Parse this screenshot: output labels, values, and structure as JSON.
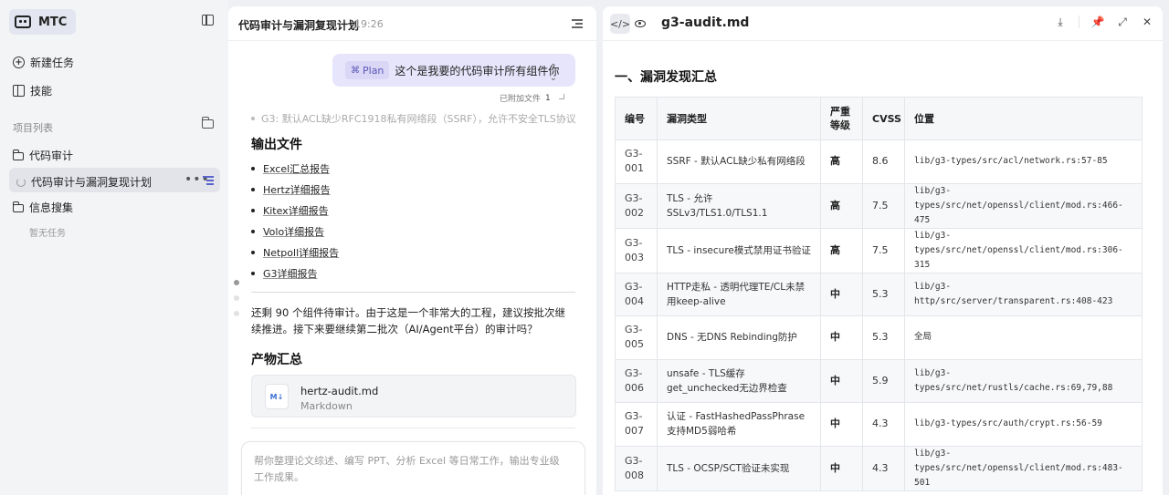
{
  "sidebar": {
    "brand": "MTC",
    "new_task": "新建任务",
    "skills": "技能",
    "section_label": "项目列表",
    "projects": [
      {
        "label": "代码审计"
      },
      {
        "label": "代码审计与漏洞复现计划"
      },
      {
        "label": "信息搜集"
      }
    ],
    "empty_text": "暂无任务",
    "more": "•••"
  },
  "chat": {
    "title": "代码审计与漏洞复现计划",
    "time": "19:26",
    "plan_tag": "Plan",
    "plan_text": "这个是我要的代码审计所有组件你",
    "attached_label": "已附加文件",
    "attached_count": "1",
    "faded_line": "G3: 默认ACL缺少RFC1918私有网络段（SSRF），允许不安全TLS协议",
    "output_heading": "输出文件",
    "output_files": [
      "Excel汇总报告",
      "Hertz详细报告",
      "Kitex详细报告",
      "Volo详细报告",
      "Netpoll详细报告",
      "G3详细报告"
    ],
    "paragraph": "还剩 90 个组件待审计。由于这是一个非常大的工程，建议按批次继续推进。接下来要继续第二批次（AI/Agent平台）的审计吗？",
    "products_heading": "产物汇总",
    "file_card": {
      "icon": "M↓",
      "name": "hertz-audit.md",
      "type": "Markdown"
    },
    "input_placeholder": "帮你整理论文综述、编写 PPT、分析 Excel 等日常工作，输出专业级工作成果。"
  },
  "doc": {
    "filename": "g3-audit.md",
    "heading": "一、漏洞发现汇总",
    "columns": [
      "编号",
      "漏洞类型",
      "严重等级",
      "CVSS",
      "位置"
    ],
    "rows": [
      [
        "G3-001",
        "SSRF - 默认ACL缺少私有网络段",
        "高",
        "8.6",
        "lib/g3-types/src/acl/network.rs:57-85"
      ],
      [
        "G3-002",
        "TLS - 允许SSLv3/TLS1.0/TLS1.1",
        "高",
        "7.5",
        "lib/g3-types/src/net/openssl/client/mod.rs:466-475"
      ],
      [
        "G3-003",
        "TLS - insecure模式禁用证书验证",
        "高",
        "7.5",
        "lib/g3-types/src/net/openssl/client/mod.rs:306-315"
      ],
      [
        "G3-004",
        "HTTP走私 - 透明代理TE/CL未禁用keep-alive",
        "中",
        "5.3",
        "lib/g3-http/src/server/transparent.rs:408-423"
      ],
      [
        "G3-005",
        "DNS - 无DNS Rebinding防护",
        "中",
        "5.3",
        "全局"
      ],
      [
        "G3-006",
        "unsafe - TLS缓存get_unchecked无边界检查",
        "中",
        "5.9",
        "lib/g3-types/src/net/rustls/cache.rs:69,79,88"
      ],
      [
        "G3-007",
        "认证 - FastHashedPassPhrase支持MD5弱哈希",
        "中",
        "4.3",
        "lib/g3-types/src/auth/crypt.rs:56-59"
      ],
      [
        "G3-008",
        "TLS - OCSP/SCT验证未实现",
        "中",
        "4.3",
        "lib/g3-types/src/net/openssl/client/mod.rs:483-501"
      ]
    ]
  }
}
